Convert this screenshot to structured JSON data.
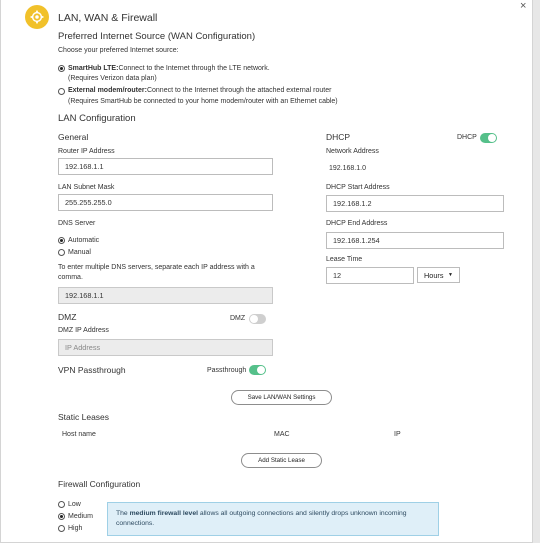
{
  "header": {
    "title": "LAN, WAN & Firewall",
    "close_glyph": "×",
    "icon": "gear-icon"
  },
  "wan": {
    "title": "Preferred Internet Source (WAN Configuration)",
    "prompt": "Choose your preferred Internet source:",
    "options": [
      {
        "name": "SmartHub LTE:",
        "desc": "Connect to the Internet through the LTE network.",
        "note": "(Requires Verizon data plan)",
        "selected": true
      },
      {
        "name": "External modem/router:",
        "desc": "Connect to the Internet through the attached external router",
        "note": "(Requires SmartHub be connected to your home modem/router with an Ethernet cable)",
        "selected": false
      }
    ]
  },
  "lan": {
    "title": "LAN Configuration",
    "general": {
      "title": "General",
      "router_ip_label": "Router IP Address",
      "router_ip": "192.168.1.1",
      "subnet_label": "LAN Subnet Mask",
      "subnet": "255.255.255.0",
      "dns_label": "DNS Server",
      "dns_options": [
        "Automatic",
        "Manual"
      ],
      "dns_selected": "Automatic",
      "dns_hint": "To enter multiple DNS servers, separate each IP address with a comma.",
      "dns_value": "192.168.1.1"
    },
    "dhcp": {
      "title": "DHCP",
      "toggle_label": "DHCP",
      "enabled": true,
      "network_label": "Network Address",
      "network": "192.168.1.0",
      "start_label": "DHCP Start Address",
      "start": "192.168.1.2",
      "end_label": "DHCP End Address",
      "end": "192.168.1.254",
      "lease_label": "Lease Time",
      "lease_value": "12",
      "lease_unit": "Hours"
    },
    "dmz": {
      "title": "DMZ",
      "toggle_label": "DMZ",
      "enabled": false,
      "ip_label": "DMZ IP Address",
      "ip_placeholder": "IP Address"
    },
    "vpn": {
      "title": "VPN Passthrough",
      "toggle_label": "Passthrough",
      "enabled": true
    },
    "save_label": "Save LAN/WAN Settings"
  },
  "static_leases": {
    "title": "Static Leases",
    "columns": [
      "Host name",
      "MAC",
      "IP"
    ],
    "add_label": "Add Static Lease"
  },
  "firewall": {
    "title": "Firewall Configuration",
    "levels": [
      "Low",
      "Medium",
      "High"
    ],
    "selected": "Medium",
    "info_pre": "The ",
    "info_bold": "medium firewall level",
    "info_post": " allows all outgoing connections and silently drops unknown incoming connections."
  },
  "colors": {
    "accent_green": "#55c08a",
    "badge_yellow": "#f1c12a",
    "info_bg": "#dfeff8"
  }
}
